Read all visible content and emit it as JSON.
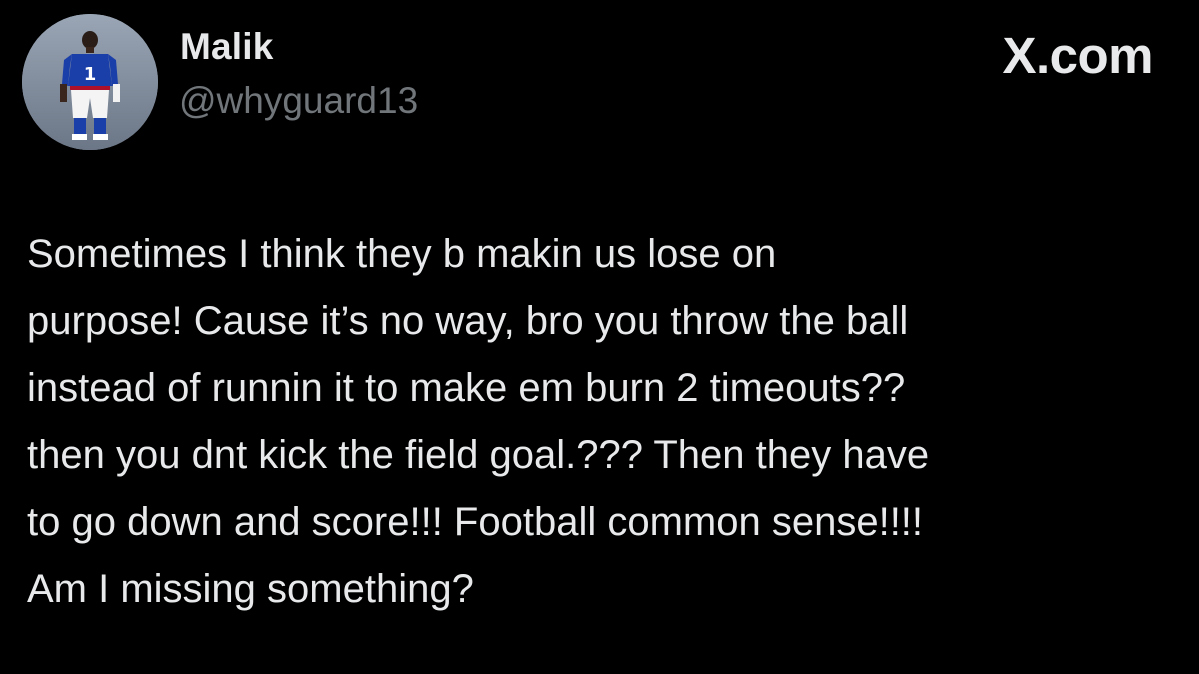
{
  "tweet": {
    "author": {
      "name": "Malik",
      "handle": "@whyguard13",
      "avatar": "football-player-avatar"
    },
    "brand": "X.com",
    "text_lines": [
      "Sometimes I think they b makin us lose on",
      "purpose! Cause it’s no way, bro you throw the ball",
      "instead of runnin it to make em burn 2 timeouts??",
      "then you dnt kick the field goal.??? Then they have",
      "to go down and score!!! Football common sense!!!!",
      "Am I missing something?"
    ]
  },
  "colors": {
    "background": "#000000",
    "primary_text": "#e7e9ea",
    "secondary_text": "#71767b",
    "jersey_blue": "#1b3fa8"
  }
}
